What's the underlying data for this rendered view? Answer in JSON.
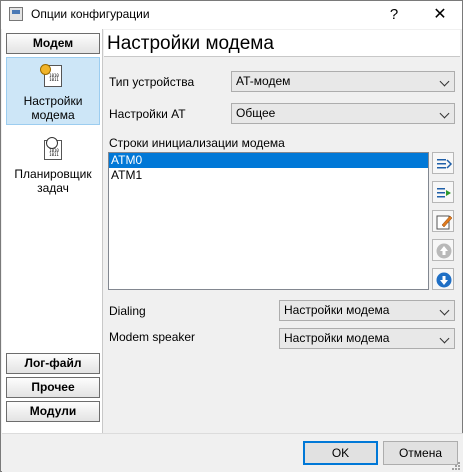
{
  "window": {
    "title": "Опции конфигурации",
    "help_glyph": "?",
    "close_glyph": "✕"
  },
  "nav": {
    "header": "Модем",
    "items": [
      {
        "label": "Настройки модема",
        "icon": "modem-settings-icon",
        "selected": true
      },
      {
        "label": "Планировщик задач",
        "icon": "scheduler-clock-icon",
        "selected": false
      }
    ],
    "bottom_buttons": [
      "Лог-файл",
      "Прочее",
      "Модули"
    ]
  },
  "panel": {
    "title": "Настройки модема",
    "device_type": {
      "label": "Тип устройства",
      "value": "AT-модем"
    },
    "at_settings": {
      "label": "Настройки AT",
      "value": "Общее"
    },
    "init_strings": {
      "label": "Строки инициализации модема",
      "rows": [
        "ATM0",
        "ATM1"
      ],
      "selected_index": 0
    },
    "dialing": {
      "label": "Dialing",
      "value": "Настройки модема"
    },
    "speaker": {
      "label": "Modem speaker",
      "value": "Настройки модема"
    },
    "toolbar": [
      "add-line-icon",
      "insert-line-icon",
      "edit-icon",
      "move-up-icon",
      "move-down-icon"
    ]
  },
  "footer": {
    "ok": "OK",
    "cancel": "Отмена"
  },
  "colors": {
    "selection": "#0078d7",
    "nav_selected": "#cde6f7"
  }
}
